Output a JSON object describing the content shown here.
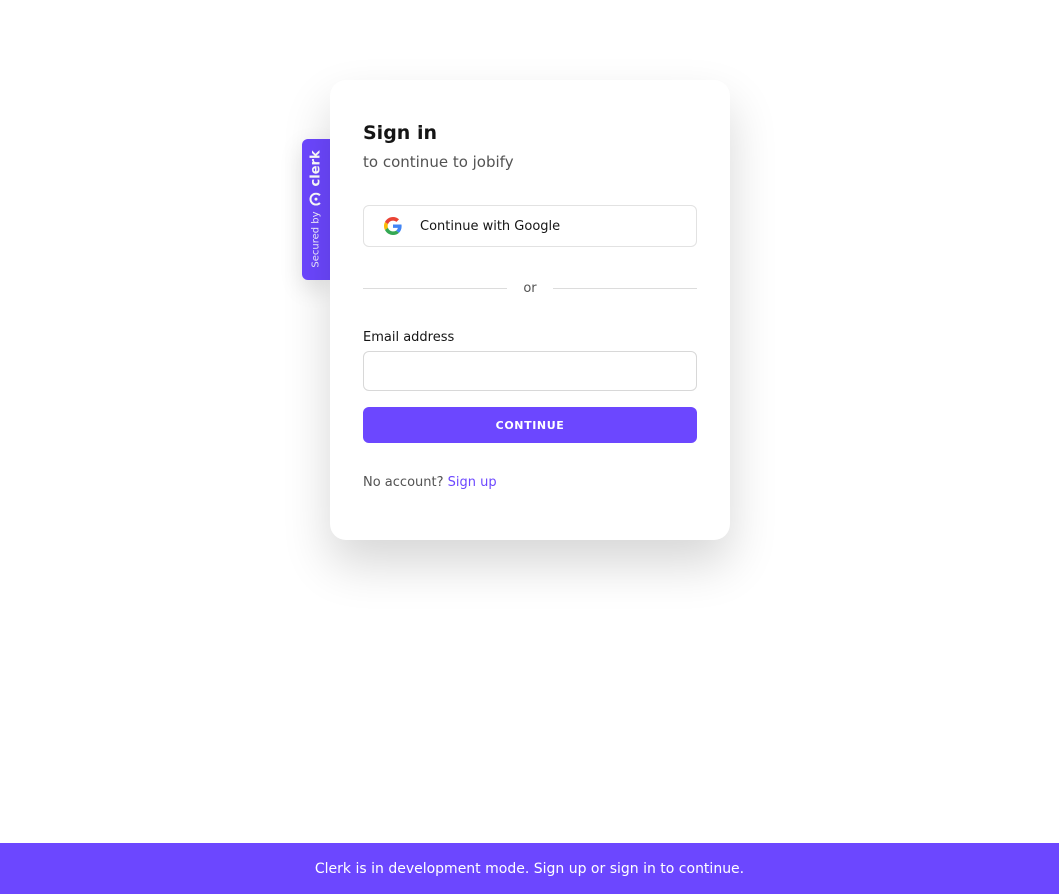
{
  "badge": {
    "secured_by": "Secured by",
    "brand": "clerk",
    "logo_icon": "clerk-logo-icon"
  },
  "signin": {
    "title": "Sign in",
    "subtitle": "to continue to jobify",
    "google_label": "Continue with Google",
    "google_icon": "google-icon",
    "divider_text": "or",
    "email_label": "Email address",
    "email_value": "",
    "email_placeholder": "",
    "continue_label": "CONTINUE",
    "no_account_text": "No account?",
    "signup_link": "Sign up"
  },
  "banner": {
    "text": "Clerk is in development mode. Sign up or sign in to continue."
  },
  "colors": {
    "accent": "#6c47ff",
    "text": "#151515",
    "muted": "#535353",
    "border": "#e2e2e2"
  }
}
